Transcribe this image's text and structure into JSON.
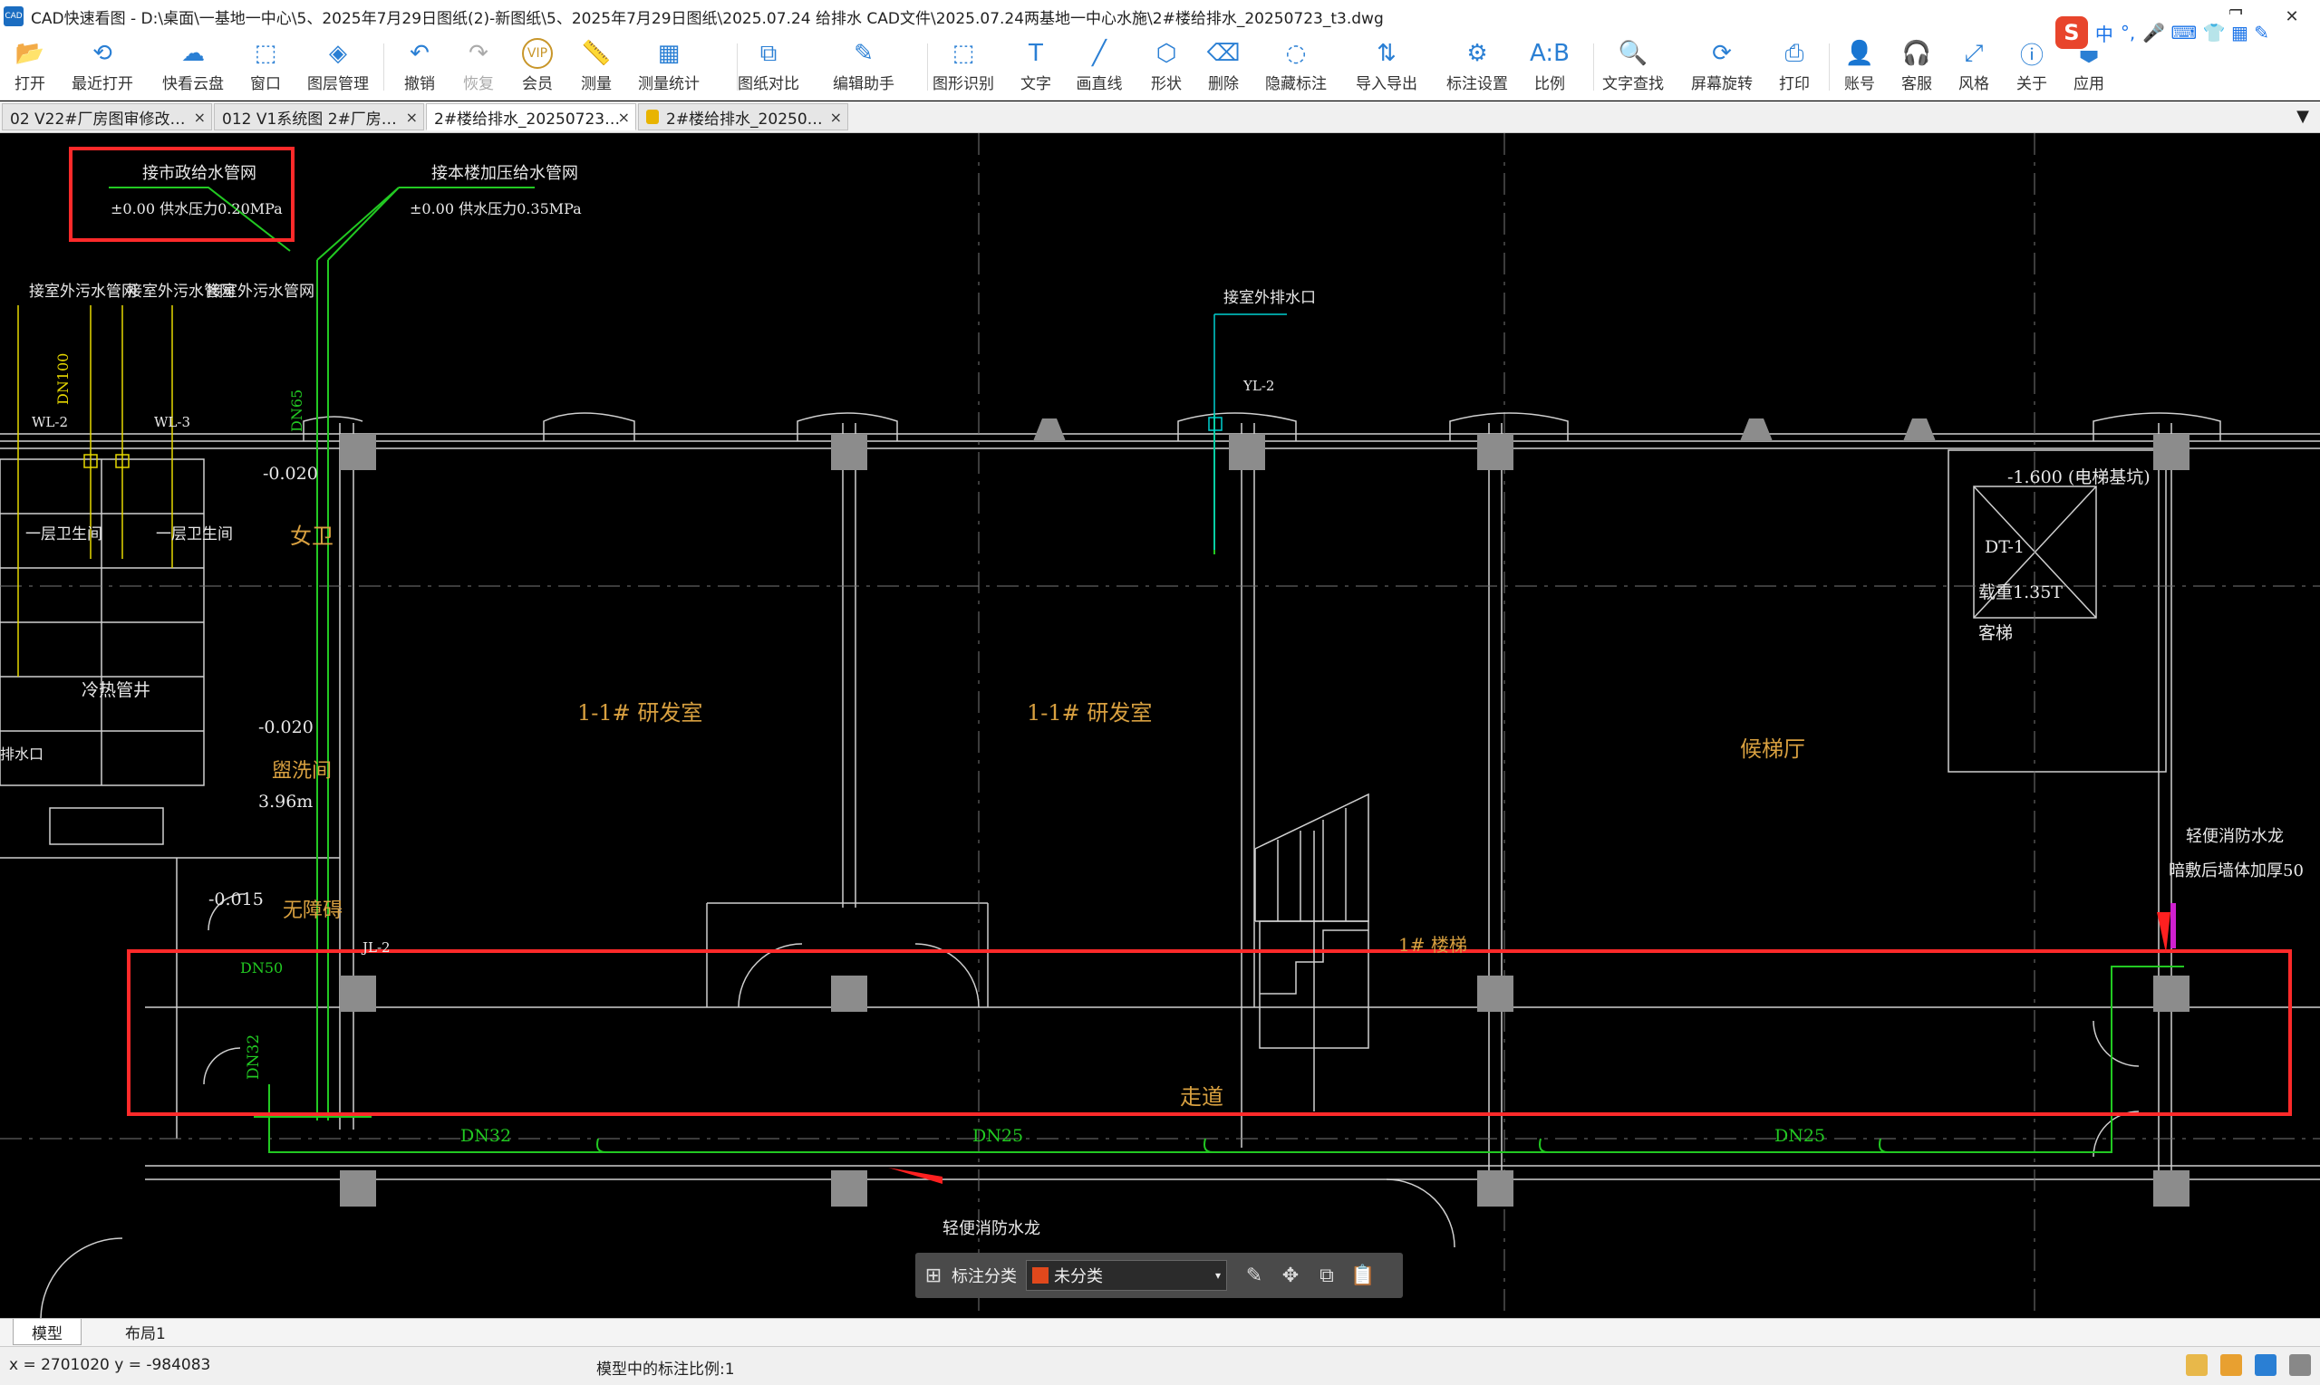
{
  "window": {
    "app_icon": "CAD",
    "title": "CAD快速看图 - D:\\桌面\\一基地一中心\\5、2025年7月29日图纸(2)-新图纸\\5、2025年7月29日图纸\\2025.07.24 给排水 CAD文件\\2025.07.24两基地一中心水施\\2#楼给排水_20250723_t3.dwg",
    "minimize": "—",
    "restore": "❐",
    "close": "✕"
  },
  "toolbar": [
    {
      "label": "打开",
      "icon": "folder-open-icon",
      "glyph": "📂"
    },
    {
      "label": "最近打开",
      "icon": "recent-icon",
      "glyph": "⟲"
    },
    {
      "label": "快看云盘",
      "icon": "cloud-icon",
      "glyph": "☁"
    },
    {
      "label": "窗口",
      "icon": "window-icon",
      "glyph": "⬚"
    },
    {
      "label": "图层管理",
      "icon": "layers-icon",
      "glyph": "◈"
    },
    {
      "label": "撤销",
      "icon": "undo-icon",
      "glyph": "↶"
    },
    {
      "label": "恢复",
      "icon": "redo-icon",
      "glyph": "↷"
    },
    {
      "label": "会员",
      "icon": "vip-icon",
      "glyph": "VIP"
    },
    {
      "label": "测量",
      "icon": "ruler-icon",
      "glyph": "📏"
    },
    {
      "label": "测量统计",
      "icon": "measure-stats-icon",
      "glyph": "▦"
    },
    {
      "label": "图纸对比",
      "icon": "compare-icon",
      "glyph": "⧉"
    },
    {
      "label": "编辑助手",
      "icon": "edit-assistant-icon",
      "glyph": "✎"
    },
    {
      "label": "图形识别",
      "icon": "shape-recognize-icon",
      "glyph": "⬚"
    },
    {
      "label": "文字",
      "icon": "text-icon",
      "glyph": "T"
    },
    {
      "label": "画直线",
      "icon": "line-icon",
      "glyph": "╱"
    },
    {
      "label": "形状",
      "icon": "shape-icon",
      "glyph": "⬡"
    },
    {
      "label": "删除",
      "icon": "eraser-icon",
      "glyph": "⌫"
    },
    {
      "label": "隐藏标注",
      "icon": "hide-annotation-icon",
      "glyph": "◌"
    },
    {
      "label": "导入导出",
      "icon": "import-export-icon",
      "glyph": "⇅"
    },
    {
      "label": "标注设置",
      "icon": "annotation-settings-icon",
      "glyph": "⚙"
    },
    {
      "label": "比例",
      "icon": "scale-icon",
      "glyph": "A:B"
    },
    {
      "label": "文字查找",
      "icon": "text-search-icon",
      "glyph": "🔍"
    },
    {
      "label": "屏幕旋转",
      "icon": "rotate-screen-icon",
      "glyph": "⟳"
    },
    {
      "label": "打印",
      "icon": "print-icon",
      "glyph": "⎙"
    },
    {
      "label": "账号",
      "icon": "account-icon",
      "glyph": "👤"
    },
    {
      "label": "客服",
      "icon": "headset-icon",
      "glyph": "🎧"
    },
    {
      "label": "风格",
      "icon": "style-icon",
      "glyph": "⤢"
    },
    {
      "label": "关于",
      "icon": "info-icon",
      "glyph": "ⓘ"
    },
    {
      "label": "应用",
      "icon": "apps-icon",
      "glyph": "⬢"
    }
  ],
  "ime": {
    "logo": "S",
    "mode": "中",
    "punct": "°,",
    "extra": "🎤 ⌨ 👕 ▦ ✎"
  },
  "tabs": [
    {
      "label": "02 V22#厂房图审修改…",
      "close": "×"
    },
    {
      "label": "012 V1系统图 2#厂房…",
      "close": "×"
    },
    {
      "label": "2#楼给排水_20250723…",
      "close": "×",
      "active": true
    },
    {
      "label": "2#楼给排水_20250…",
      "close": "×",
      "locked": true
    }
  ],
  "tab_menu": "▼",
  "drawing": {
    "rooms": [
      {
        "label": "1-1#  研发室"
      },
      {
        "label": "1-1#  研发室"
      },
      {
        "label": "候梯厅"
      },
      {
        "label": "走道"
      },
      {
        "label": "1# 楼梯"
      },
      {
        "label": "女卫"
      },
      {
        "label": "盥洗间"
      },
      {
        "label": "无障碍"
      },
      {
        "label": "冷热管井"
      }
    ],
    "notes": {
      "supply1": "接市政给水管网",
      "supply1_sub": "±0.00  供水压力0.20MPa",
      "supply2": "接本楼加压给水管网",
      "supply2_sub": "±0.00  供水压力0.35MPa",
      "sewer1": "接室外污水管网",
      "sewer2": "接室外污水管网",
      "sewer3": "接室外污水管网",
      "rain": "接室外排水口",
      "elev_pit": "-1.600  (电梯基坑)",
      "dt": "DT-1",
      "load": "载重1.35T",
      "elev": "客梯",
      "fire1": "轻便消防水龙",
      "fire1_sub": "暗敷后墙体加厚50",
      "fire2": "轻便消防水龙",
      "lvl1": "-0.020",
      "lvl2": "-0.020",
      "lvl3": "-0.015",
      "h": "3.96m",
      "toilet1": "一层卫生间",
      "toilet2": "一层卫生间",
      "wl2": "WL-2",
      "wl3": "WL-3",
      "yl2": "YL-2",
      "jl2": "JL-2",
      "side": "排水口",
      "pipe_dn32a": "DN32",
      "pipe_dn32b": "DN32",
      "pipe_dn25a": "DN25",
      "pipe_dn25b": "DN25",
      "pipe_dn50": "DN50",
      "pipe_dn100": "DN100",
      "pipe_dn65": "DN65"
    }
  },
  "annotation_bar": {
    "label": "标注分类",
    "category": "未分类",
    "dropdown": "▾"
  },
  "layout_tabs": [
    {
      "label": "模型",
      "active": true
    },
    {
      "label": "布局1"
    }
  ],
  "status": {
    "coords": "x = 2701020  y = -984083",
    "scale": "模型中的标注比例:1"
  }
}
